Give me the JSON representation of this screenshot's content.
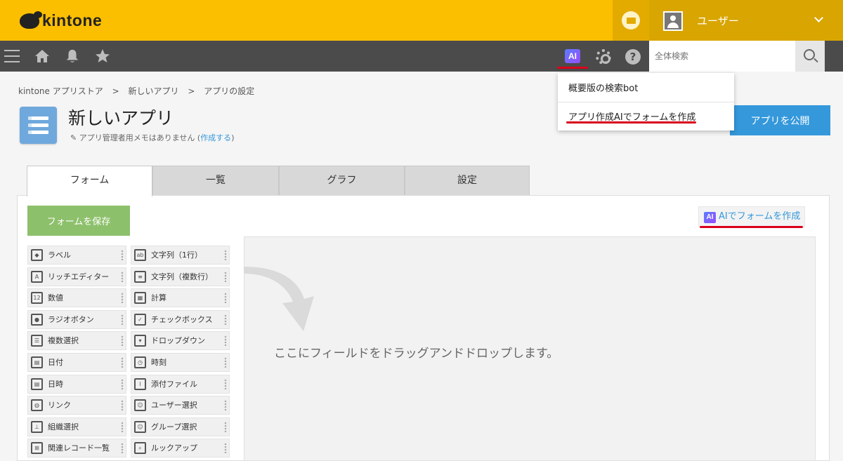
{
  "header": {
    "logo_text": "kintone",
    "user_name": "ユーザー",
    "search_placeholder": "全体検索",
    "ai_badge": "AI"
  },
  "breadcrumb": [
    "kintone アプリストア",
    "新しいアプリ",
    "アプリの設定"
  ],
  "breadcrumb_sep": ">",
  "app": {
    "title": "新しいアプリ",
    "memo": "アプリ管理者用メモはありません",
    "memo_link": "作成する",
    "publish_label": "アプリを公開"
  },
  "ai_menu": {
    "items": [
      "概要版の検索bot",
      "アプリ作成AIでフォームを作成"
    ]
  },
  "tabs": [
    "フォーム",
    "一覧",
    "グラフ",
    "設定"
  ],
  "form": {
    "save_label": "フォームを保存",
    "ai_create_label": "AIでフォームを作成",
    "ai_create_badge": "AI",
    "drop_hint": "ここにフィールドをドラッグアンドドロップします。"
  },
  "fields": [
    {
      "label": "ラベル",
      "icon": "tag-icon"
    },
    {
      "label": "文字列（1行）",
      "icon": "text-line-icon"
    },
    {
      "label": "リッチエディター",
      "icon": "rich-editor-icon"
    },
    {
      "label": "文字列（複数行）",
      "icon": "text-multiline-icon"
    },
    {
      "label": "数値",
      "icon": "number-icon"
    },
    {
      "label": "計算",
      "icon": "calculator-icon"
    },
    {
      "label": "ラジオボタン",
      "icon": "radio-icon"
    },
    {
      "label": "チェックボックス",
      "icon": "checkbox-icon"
    },
    {
      "label": "複数選択",
      "icon": "multi-select-icon"
    },
    {
      "label": "ドロップダウン",
      "icon": "dropdown-icon"
    },
    {
      "label": "日付",
      "icon": "calendar-icon"
    },
    {
      "label": "時刻",
      "icon": "clock-icon"
    },
    {
      "label": "日時",
      "icon": "datetime-icon"
    },
    {
      "label": "添付ファイル",
      "icon": "paperclip-icon"
    },
    {
      "label": "リンク",
      "icon": "globe-icon"
    },
    {
      "label": "ユーザー選択",
      "icon": "user-icon"
    },
    {
      "label": "組織選択",
      "icon": "org-icon"
    },
    {
      "label": "グループ選択",
      "icon": "group-icon"
    },
    {
      "label": "関連レコード一覧",
      "icon": "related-records-icon"
    },
    {
      "label": "ルックアップ",
      "icon": "lookup-icon"
    }
  ],
  "colors": {
    "topbar": "#fcbf00",
    "navbar": "#4b4b4b",
    "accent": "#3498db",
    "save": "#8dc06b",
    "highlight": "#d9001b"
  }
}
